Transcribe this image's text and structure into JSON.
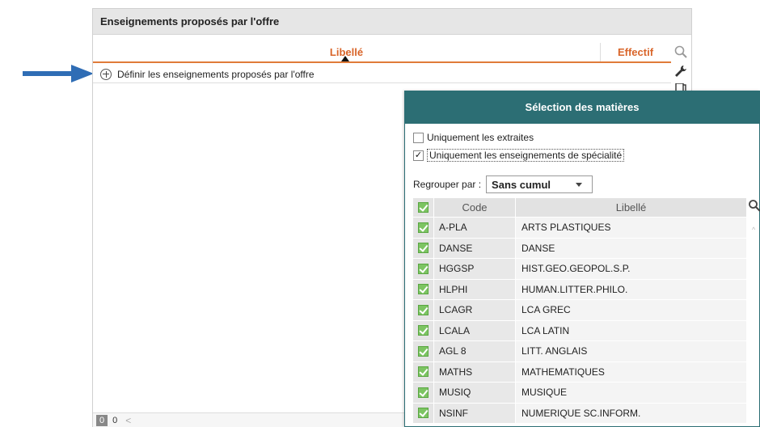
{
  "panel": {
    "title": "Enseignements proposés par l'offre",
    "columns": {
      "libelle": "Libellé",
      "effectif": "Effectif"
    },
    "define_row_label": "Définir les enseignements proposés par l'offre",
    "footer": {
      "count_a": "0",
      "count_b": "0",
      "scroll_left": "<"
    }
  },
  "dialog": {
    "title": "Sélection des matières",
    "options": [
      {
        "label": "Uniquement les extraites",
        "checked": false
      },
      {
        "label": "Uniquement les enseignements de spécialité",
        "checked": true
      }
    ],
    "group_label": "Regrouper par :",
    "group_value": "Sans cumul",
    "table": {
      "headers": {
        "code": "Code",
        "libelle": "Libellé"
      },
      "rows": [
        {
          "code": "A-PLA",
          "libelle": "ARTS PLASTIQUES",
          "checked": true
        },
        {
          "code": "DANSE",
          "libelle": "DANSE",
          "checked": true
        },
        {
          "code": "HGGSP",
          "libelle": "HIST.GEO.GEOPOL.S.P.",
          "checked": true
        },
        {
          "code": "HLPHI",
          "libelle": "HUMAN.LITTER.PHILO.",
          "checked": true
        },
        {
          "code": "LCAGR",
          "libelle": "LCA GREC",
          "checked": true
        },
        {
          "code": "LCALA",
          "libelle": "LCA LATIN",
          "checked": true
        },
        {
          "code": "AGL 8",
          "libelle": "LITT. ANGLAIS",
          "checked": true
        },
        {
          "code": "MATHS",
          "libelle": "MATHEMATIQUES",
          "checked": true
        },
        {
          "code": "MUSIQ",
          "libelle": "MUSIQUE",
          "checked": true
        },
        {
          "code": "NSINF",
          "libelle": "NUMERIQUE SC.INFORM.",
          "checked": true
        }
      ]
    }
  },
  "colors": {
    "accent_orange": "#d9652a",
    "dialog_teal": "#2c6e74",
    "arrow_blue": "#2f6db5",
    "check_green": "#7cc462"
  },
  "icons": [
    "arrow-right-icon",
    "sort-up-icon",
    "search-icon",
    "wrench-icon",
    "copy-icon",
    "add-circle-icon",
    "dropdown-caret-icon",
    "check-icon"
  ]
}
